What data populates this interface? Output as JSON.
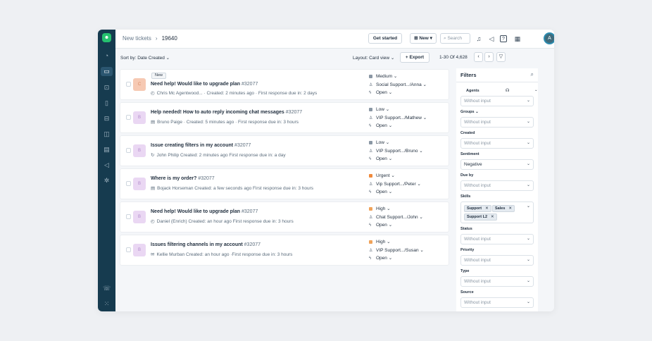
{
  "app": {
    "logo_text": "☻"
  },
  "sidebar": {
    "items": [
      {
        "icon": "dashboard-icon",
        "glyph": "◔"
      },
      {
        "icon": "tickets-icon",
        "glyph": "▭"
      },
      {
        "icon": "contacts-icon",
        "glyph": "⊡"
      },
      {
        "icon": "book-icon",
        "glyph": "▯"
      },
      {
        "icon": "inbox-icon",
        "glyph": "⊟"
      },
      {
        "icon": "reports-icon",
        "glyph": "◫"
      },
      {
        "icon": "chat-icon",
        "glyph": "▤"
      },
      {
        "icon": "megaphone-icon",
        "glyph": "◁"
      },
      {
        "icon": "settings-icon",
        "glyph": "✲"
      },
      {
        "icon": "phone-icon",
        "glyph": "☏"
      },
      {
        "icon": "apps-icon",
        "glyph": "⁙"
      }
    ]
  },
  "header": {
    "breadcrumb_parent": "New tickets",
    "breadcrumb_sep": "›",
    "breadcrumb_current": "19640",
    "get_started_label": "Get started",
    "new_label": "⊞ New ▾",
    "search_placeholder": "Search",
    "search_glyph": "⌕",
    "icons": [
      {
        "name": "notification-icon",
        "glyph": "♫"
      },
      {
        "name": "announcement-icon",
        "glyph": "◁"
      },
      {
        "name": "help-icon",
        "glyph": "?"
      },
      {
        "name": "marketplace-icon",
        "glyph": "▦"
      }
    ],
    "avatar_initial": "A"
  },
  "toolbar": {
    "sort_label": "Sort by: Date Created ⌄",
    "layout_label": "Layout: Card view ⌄",
    "export_label": "+ Export",
    "pager_text": "1-30 Of 4,628",
    "prev_glyph": "‹",
    "next_glyph": "›",
    "filter_glyph": "▽"
  },
  "tickets": [
    {
      "new_badge": "New",
      "initial": "C",
      "avatar_color": "#f6c9b3",
      "subject": "Need help! Would like to upgrade plan",
      "number": "#32077",
      "meta_icon": "◴",
      "meta": "Chris Mc Agentwood... · Created: 2 minutes ago · First response due in: 2 days",
      "priority": "Medium ⌄",
      "priority_color": "#8a97a4",
      "group": "Social Support.../Anna  ⌄",
      "status": "Open ⌄"
    },
    {
      "new_badge": "",
      "initial": "B",
      "avatar_color": "#ead7f3",
      "subject": "Help needed! How to auto reply incoming chat messages",
      "number": "#32077",
      "meta_icon": "▤",
      "meta": "Bruno Paige · Created: 5 minutes ago · First response due in: 3 hours",
      "priority": "Low ⌄",
      "priority_color": "#8a97a4",
      "group": "VIP Support.../Mathew ⌄",
      "status": "Open ⌄"
    },
    {
      "new_badge": "",
      "initial": "B",
      "avatar_color": "#ead7f3",
      "subject": "Issue creating filters in my account",
      "number": "#32077",
      "meta_icon": "↻",
      "meta": "John Philip   Created: 2 minutes ago   First response due in: a day",
      "priority": "Low ⌄",
      "priority_color": "#8a97a4",
      "group": "VIP Support.../Bruno   ⌄",
      "status": "Open ⌄"
    },
    {
      "new_badge": "",
      "initial": "B",
      "avatar_color": "#ead7f3",
      "subject": "Where is my order?",
      "number": "#32077",
      "meta_icon": "▤",
      "meta": "Bojack Horseman   Created: a few seconds ago   First response due in: 3 hours",
      "priority": "Urgent ⌄",
      "priority_color": "#f08a3c",
      "group": "Vip Support.../Peter     ⌄",
      "status": "Open ⌄"
    },
    {
      "new_badge": "",
      "initial": "B",
      "avatar_color": "#ead7f3",
      "subject": "Need help! Would like to upgrade plan",
      "number": "#32077",
      "meta_icon": "◴",
      "meta": "Daniel (Enrich)   Created: an hour ago   First response due in: 3 hours",
      "priority": "High ⌄",
      "priority_color": "#f0a35a",
      "group": "Chat Support.../John     ⌄",
      "status": "Open ⌄"
    },
    {
      "new_badge": "",
      "initial": "B",
      "avatar_color": "#ead7f3",
      "subject": "Issues filtering channels in my account",
      "number": "#32077",
      "meta_icon": "✉",
      "meta": "Kellie Murban   Created: an hour ago  ·First response due in: 3 hours",
      "priority": "High ⌄",
      "priority_color": "#f0a35a",
      "group": "VIP Support.../Susan     ⌄",
      "status": "Open ⌄"
    }
  ],
  "filters": {
    "title": "Filters",
    "search_glyph": "⌕",
    "agents_label": "Agents",
    "agents_icon": "☊",
    "agents_chevron": "⌄",
    "groups_label": "Groups ⌄",
    "created_label": "Created",
    "sentiment_label": "Sentiment",
    "sentiment_value": "Negative",
    "due_by_label": "Due by",
    "skills_label": "Skills",
    "skills_tags": [
      "Support",
      "Sales",
      "Support L2"
    ],
    "tag_remove_glyph": "✕",
    "status_label": "Status",
    "priority_label": "Priority",
    "type_label": "Type",
    "source_label": "Source",
    "placeholder": "Without input",
    "chevron": "⌄"
  }
}
